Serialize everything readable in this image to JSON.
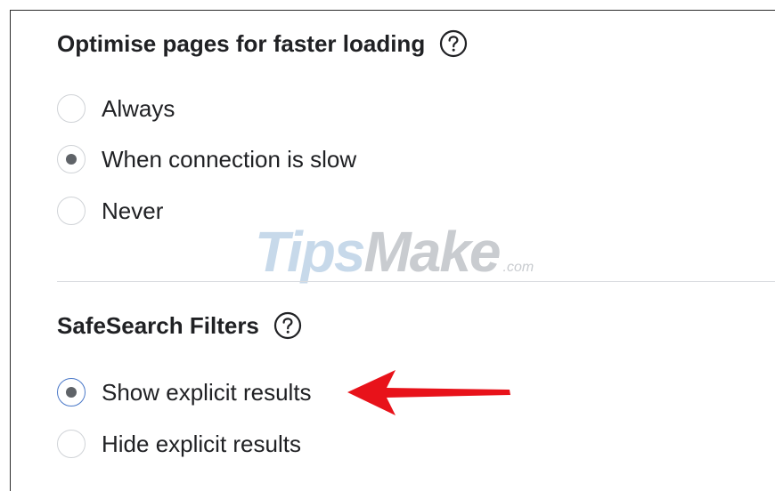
{
  "speed_section": {
    "title": "Optimise pages for faster loading",
    "help_icon": "help-circle-icon",
    "options": [
      {
        "label": "Always",
        "checked": false
      },
      {
        "label": "When connection is slow",
        "checked": true
      },
      {
        "label": "Never",
        "checked": false
      }
    ]
  },
  "safesearch_section": {
    "title": "SafeSearch Filters",
    "help_icon": "help-circle-icon",
    "options": [
      {
        "label": "Show explicit results",
        "checked": true
      },
      {
        "label": "Hide explicit results",
        "checked": false
      }
    ]
  },
  "watermark": {
    "tips": "Tips",
    "make": "Make",
    "domain": ".com"
  },
  "colors": {
    "arrow": "#e8121a",
    "radio_checked_dot": "#5f6368",
    "radio_focus_border": "#4a78c8",
    "divider": "#dadce0"
  }
}
